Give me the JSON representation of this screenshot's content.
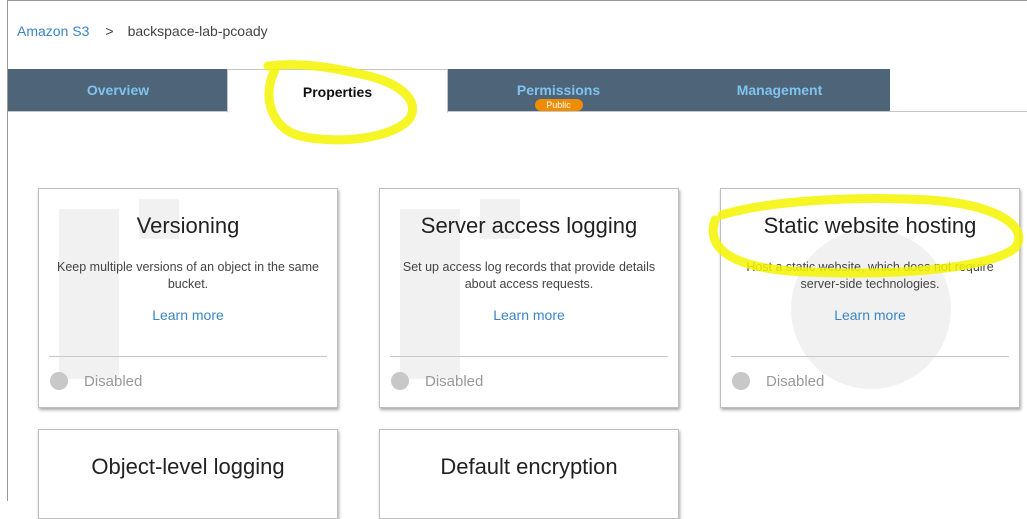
{
  "breadcrumb": {
    "root": "Amazon S3",
    "separator": ">",
    "bucket": "backspace-lab-pcoady"
  },
  "tabs": {
    "overview": "Overview",
    "properties": "Properties",
    "permissions": "Permissions",
    "permissions_badge": "Public",
    "management": "Management"
  },
  "cards": [
    {
      "title": "Versioning",
      "desc": "Keep multiple versions of an object in the same bucket.",
      "link": "Learn more",
      "status": "Disabled"
    },
    {
      "title": "Server access logging",
      "desc": "Set up access log records that provide details about access requests.",
      "link": "Learn more",
      "status": "Disabled"
    },
    {
      "title": "Static website hosting",
      "desc": "Host a static website, which does not require server-side technologies.",
      "link": "Learn more",
      "status": "Disabled"
    },
    {
      "title": "Object-level logging"
    },
    {
      "title": "Default encryption"
    }
  ],
  "colors": {
    "tab_bg": "#4e6479",
    "tab_text": "#7fc4ef",
    "link": "#3b86c4",
    "badge": "#f08c00",
    "highlight": "#f5f500"
  }
}
